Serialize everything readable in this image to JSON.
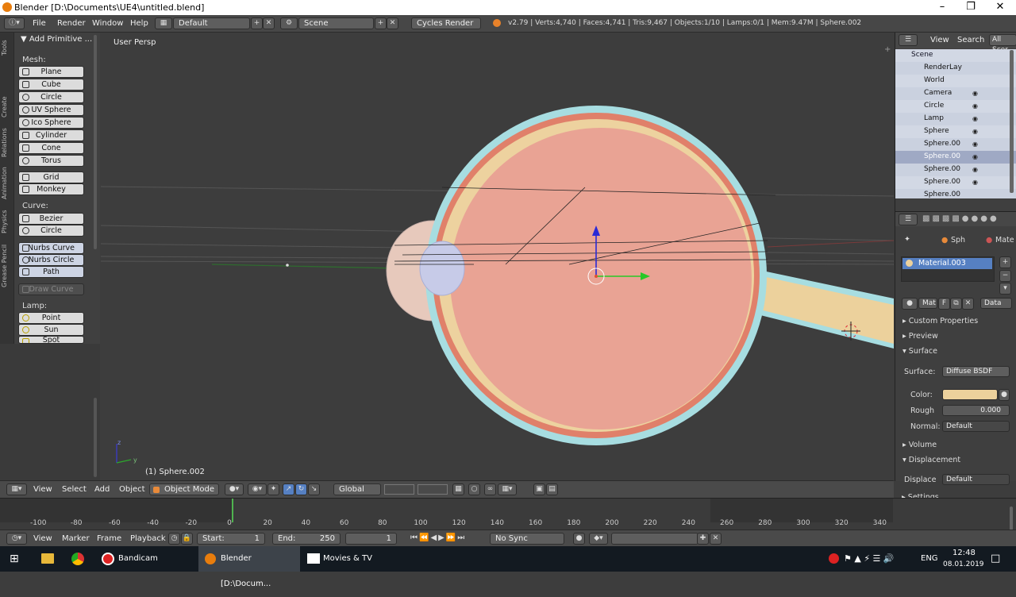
{
  "window": {
    "title": "Blender [D:\\Documents\\UE4\\untitled.blend]",
    "minimize": "–",
    "maximize": "❐",
    "close": "✕"
  },
  "info_header": {
    "menus": [
      "File",
      "Render",
      "Window",
      "Help"
    ],
    "layout": "Default",
    "scene": "Scene",
    "engine": "Cycles Render",
    "stats": "v2.79 | Verts:4,740 | Faces:4,741 | Tris:9,467 | Objects:1/10 | Lamps:0/1 | Mem:9.47M | Sphere.002"
  },
  "tool_tabs": [
    "Tools",
    "Create",
    "Relations",
    "Animation",
    "Physics",
    "Grease Pencil"
  ],
  "tool_shelf": {
    "panel_title": "▼ Add Primitive ...",
    "mesh_label": "Mesh:",
    "mesh": [
      "Plane",
      "Cube",
      "Circle",
      "UV Sphere",
      "Ico Sphere",
      "Cylinder",
      "Cone",
      "Torus",
      "Grid",
      "Monkey"
    ],
    "curve_label": "Curve:",
    "curve": [
      "Bezier",
      "Circle",
      "Nurbs Curve",
      "Nurbs Circle",
      "Path",
      "Draw Curve"
    ],
    "lamp_label": "Lamp:",
    "lamp": [
      "Point",
      "Sun",
      "Spot"
    ]
  },
  "viewport": {
    "view_label": "User Persp",
    "object_label": "(1) Sphere.002",
    "axis_z": "z",
    "axis_y": "y"
  },
  "outliner": {
    "view": "View",
    "search": "Search",
    "filter": "All Scer",
    "items": [
      "Scene",
      "RenderLay",
      "World",
      "Camera",
      "Circle",
      "Lamp",
      "Sphere",
      "Sphere.00",
      "Sphere.00",
      "Sphere.00",
      "Sphere.00",
      "Sphere.00"
    ]
  },
  "properties": {
    "breadcrumb_object": "Sph",
    "breadcrumb_material": "Mate",
    "material_slot": "Material.003",
    "mat_field": "Mat",
    "fake_user": "F",
    "data_select": "Data",
    "panels": {
      "custom": "Custom Properties",
      "preview": "Preview",
      "surface": "Surface",
      "volume": "Volume",
      "displacement": "Displacement",
      "settings": "Settings"
    },
    "surface_label": "Surface:",
    "surface_value": "Diffuse BSDF",
    "color_label": "Color:",
    "color_value": "#ecd19c",
    "roughness_label": "Rough",
    "roughness_value": "0.000",
    "normal_label": "Normal:",
    "normal_value": "Default",
    "displace_label": "Displace",
    "displace_value": "Default"
  },
  "view_header": {
    "menus": [
      "View",
      "Select",
      "Add",
      "Object"
    ],
    "mode": "Object Mode",
    "orientation": "Global"
  },
  "timeline": {
    "ticks": [
      "-100",
      "-80",
      "-60",
      "-40",
      "-20",
      "0",
      "20",
      "40",
      "60",
      "80",
      "100",
      "120",
      "140",
      "160",
      "180",
      "200",
      "220",
      "240",
      "260",
      "280",
      "300",
      "320",
      "340"
    ],
    "menus": [
      "View",
      "Marker",
      "Frame",
      "Playback"
    ],
    "start_label": "Start:",
    "start": "1",
    "end_label": "End:",
    "end": "250",
    "current": "1",
    "sync": "No Sync"
  },
  "taskbar": {
    "apps": [
      "Bandicam",
      "Blender [D:\\Docum...",
      "Movies & TV"
    ],
    "lang": "ENG",
    "time": "12:48",
    "date": "08.01.2019"
  },
  "colors": {
    "sclera": "#a7dde1",
    "outer": "#e0806a",
    "inner": "#edd29f",
    "body": "#e9a394",
    "nerve": "#ecd19c"
  }
}
